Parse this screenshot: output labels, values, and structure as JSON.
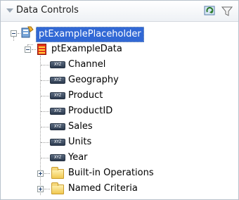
{
  "panel": {
    "title": "Data Controls",
    "tools": [
      "refresh-icon",
      "filter-icon"
    ]
  },
  "tree": {
    "root": {
      "label": "ptExamplePlaceholder",
      "icon": "data-control-icon",
      "expanded": true,
      "selected": true
    },
    "collection": {
      "label": "ptExampleData",
      "icon": "collection-icon",
      "expanded": true
    },
    "attributes": [
      {
        "label": "Channel",
        "icon_text": "XYZ"
      },
      {
        "label": "Geography",
        "icon_text": "XYZ"
      },
      {
        "label": "Product",
        "icon_text": "XYZ"
      },
      {
        "label": "ProductID",
        "icon_text": "XYZ"
      },
      {
        "label": "Sales",
        "icon_text": "XYZ"
      },
      {
        "label": "Units",
        "icon_text": "XYZ"
      },
      {
        "label": "Year",
        "icon_text": "XYZ"
      }
    ],
    "folders": [
      {
        "label": "Built-in Operations",
        "icon": "folder-icon",
        "expanded": false
      },
      {
        "label": "Named Criteria",
        "icon": "folder-icon",
        "expanded": false
      }
    ]
  },
  "colors": {
    "selection": "#3168d5",
    "accent": "#e53319"
  }
}
